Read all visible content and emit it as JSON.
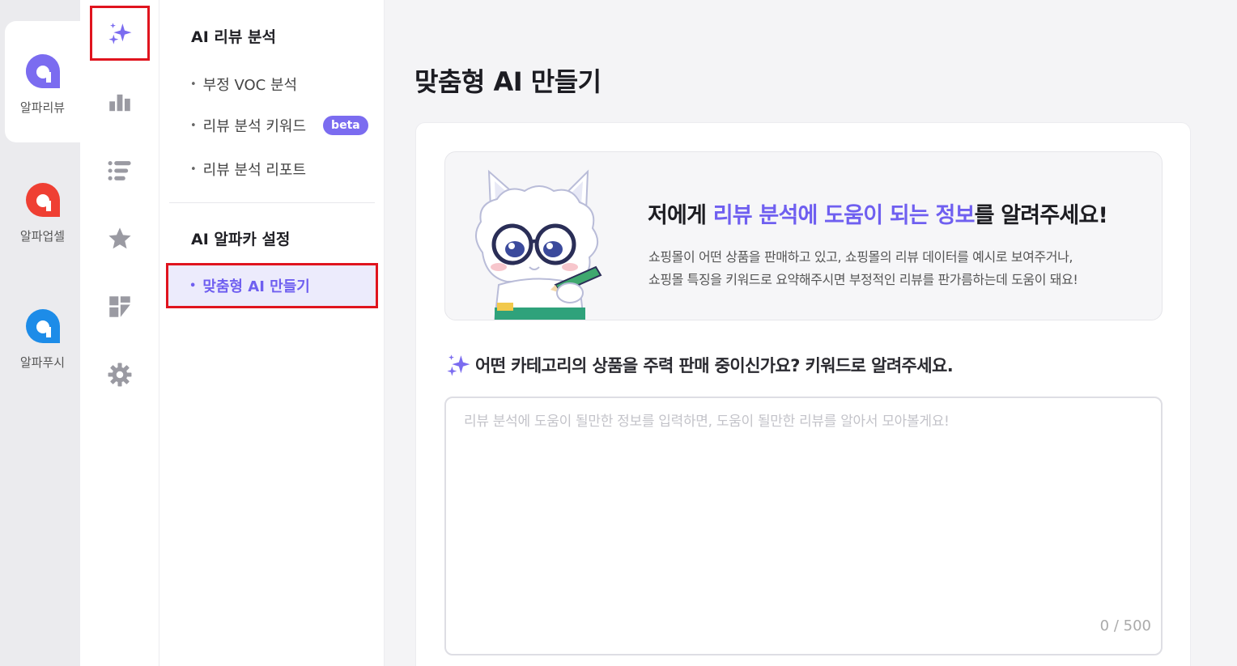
{
  "colors": {
    "accent": "#6f5ff0",
    "highlight_border": "#e0141e"
  },
  "apps": [
    {
      "label": "알파리뷰",
      "color": "#7b6cf0",
      "active": true
    },
    {
      "label": "알파업셀",
      "color": "#ef3f33",
      "active": false
    },
    {
      "label": "알파푸시",
      "color": "#1d8ce8",
      "active": false
    }
  ],
  "rail": [
    {
      "icon": "sparkle-icon",
      "active": true
    },
    {
      "icon": "bar-chart-icon"
    },
    {
      "icon": "list-icon"
    },
    {
      "icon": "star-icon"
    },
    {
      "icon": "dashboard-icon"
    },
    {
      "icon": "gear-icon"
    }
  ],
  "submenu": {
    "section1": {
      "title": "AI 리뷰 분석",
      "items": [
        {
          "label": "부정 VOC 분석"
        },
        {
          "label": "리뷰 분석 키워드",
          "badge": "beta"
        },
        {
          "label": "리뷰 분석 리포트"
        }
      ]
    },
    "section2": {
      "title": "AI 알파카 설정",
      "active_item": "맞춤형 AI 만들기"
    }
  },
  "main": {
    "title": "맞춤형 AI 만들기",
    "banner": {
      "headline_pre": "저에게 ",
      "headline_accent": "리뷰 분석에 도움이 되는 정보",
      "headline_post": "를 알려주세요!",
      "desc_line1": "쇼핑몰이 어떤 상품을 판매하고 있고, 쇼핑몰의 리뷰 데이터를 예시로 보여주거나,",
      "desc_line2": "쇼핑몰 특징을 키워드로 요약해주시면 부정적인 리뷰를 판가름하는데 도움이 돼요!"
    },
    "question": "어떤 카테고리의 상품을 주력 판매 중이신가요? 키워드로 알려주세요.",
    "textarea": {
      "placeholder": "리뷰 분석에 도움이 될만한 정보를 입력하면, 도움이 될만한 리뷰를 알아서 모아볼게요!",
      "value": "",
      "counter": "0 / 500"
    }
  }
}
